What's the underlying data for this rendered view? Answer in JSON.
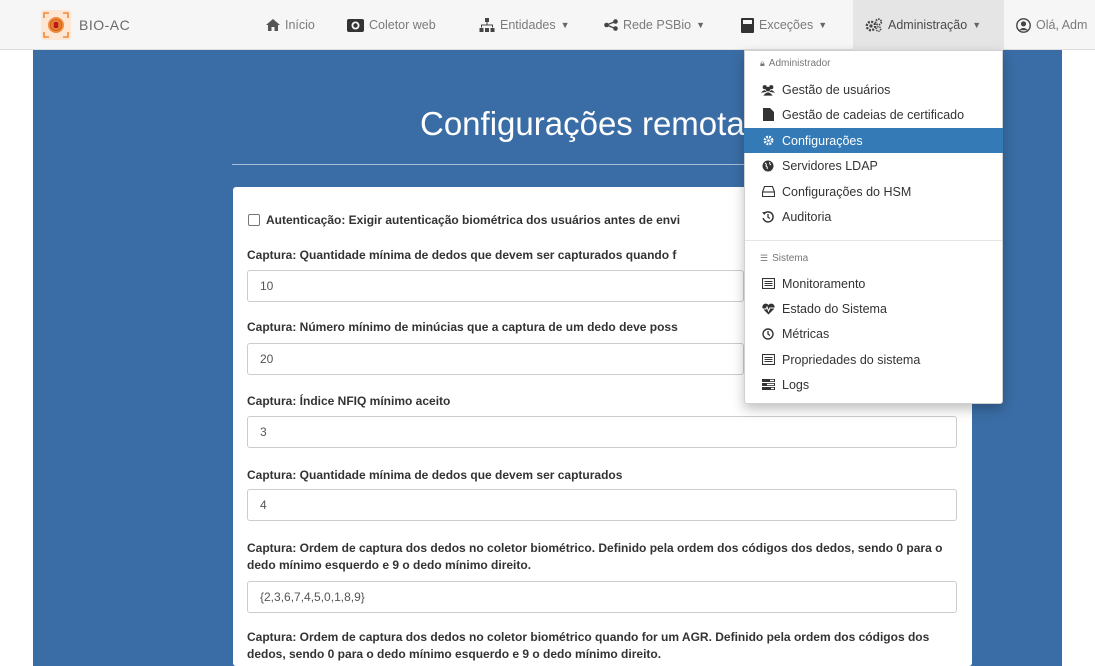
{
  "brand": {
    "name": "BIO-AC"
  },
  "nav": {
    "items": [
      {
        "label": "Início",
        "icon": "home-icon"
      },
      {
        "label": "Coletor web",
        "icon": "camera-icon"
      },
      {
        "label": "Entidades",
        "icon": "sitemap-icon"
      },
      {
        "label": "Rede PSBio",
        "icon": "share-icon"
      },
      {
        "label": "Exceções",
        "icon": "book-icon"
      },
      {
        "label": "Administração",
        "icon": "cogs-icon"
      },
      {
        "label": "Olá, Adm",
        "icon": "user-circle-icon"
      }
    ]
  },
  "page": {
    "title": "Configurações remotas"
  },
  "form": {
    "auth_label": "Autenticação: Exigir autenticação biométrica dos usuários antes de envi",
    "auth_checked": false,
    "fields": [
      {
        "label": "Captura: Quantidade mínima de dedos que devem ser capturados quando f",
        "value": "10"
      },
      {
        "label": "Captura: Número mínimo de minúcias que a captura de um dedo deve poss",
        "value": "20"
      },
      {
        "label": "Captura: Índice NFIQ mínimo aceito",
        "value": "3"
      },
      {
        "label": "Captura: Quantidade mínima de dedos que devem ser capturados",
        "value": "4"
      },
      {
        "label": "Captura: Ordem de captura dos dedos no coletor biométrico. Definido pela ordem dos códigos dos dedos, sendo 0 para o dedo mínimo esquerdo e 9 o dedo mínimo direito.",
        "value": "{2,3,6,7,4,5,0,1,8,9}"
      },
      {
        "label": "Captura: Ordem de captura dos dedos no coletor biométrico quando for um AGR. Definido pela ordem dos códigos dos dedos, sendo 0 para o dedo mínimo esquerdo e 9 o dedo mínimo direito."
      }
    ]
  },
  "dropdown": {
    "admin_header": "Administrador",
    "admin_items": [
      {
        "label": "Gestão de usuários",
        "icon": "users-icon"
      },
      {
        "label": "Gestão de cadeias de certificado",
        "icon": "file-icon"
      },
      {
        "label": "Configurações",
        "icon": "gear-icon",
        "active": true
      },
      {
        "label": "Servidores LDAP",
        "icon": "globe-icon"
      },
      {
        "label": "Configurações do HSM",
        "icon": "hdd-icon"
      },
      {
        "label": "Auditoria",
        "icon": "history-icon"
      }
    ],
    "system_header": "Sistema",
    "system_items": [
      {
        "label": "Monitoramento",
        "icon": "list-alt-icon"
      },
      {
        "label": "Estado do Sistema",
        "icon": "heartbeat-icon"
      },
      {
        "label": "Métricas",
        "icon": "clock-icon"
      },
      {
        "label": "Propriedades do sistema",
        "icon": "list-alt-icon"
      },
      {
        "label": "Logs",
        "icon": "tasks-icon"
      }
    ]
  },
  "colors": {
    "navbar_bg": "#f6f6f6",
    "main_bg": "#3a6da5",
    "active_item": "#337ab7",
    "brand_accent": "#f08a3c"
  }
}
